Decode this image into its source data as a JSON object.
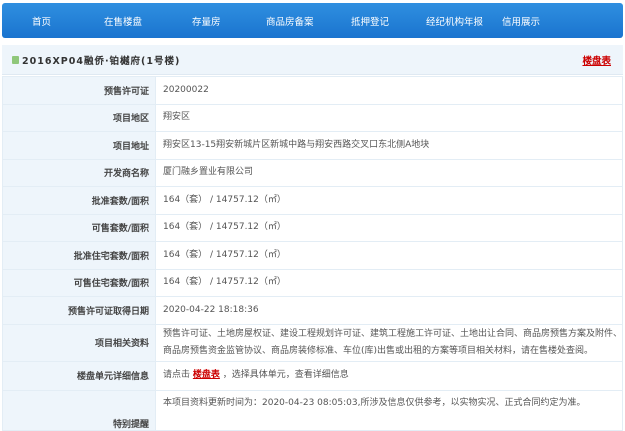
{
  "nav": [
    "首页",
    "在售楼盘",
    "存量房",
    "商品房备案",
    "抵押登记",
    "经纪机构年报",
    "信用展示"
  ],
  "title": "2016XP04融侨·铂樾府(1号楼)",
  "title_link": "楼盘表",
  "rows": [
    {
      "label": "预售许可证",
      "value": "20200022"
    },
    {
      "label": "项目地区",
      "value": "翔安区"
    },
    {
      "label": "项目地址",
      "value": "翔安区13-15翔安新城片区新城中路与翔安西路交叉口东北侧A地块"
    },
    {
      "label": "开发商名称",
      "value": "厦门融乡置业有限公司"
    },
    {
      "label": "批准套数/面积",
      "value": "164（套） / 14757.12（㎡）"
    },
    {
      "label": "可售套数/面积",
      "value": "164（套） / 14757.12（㎡）"
    },
    {
      "label": "批准住宅套数/面积",
      "value": "164（套） / 14757.12（㎡）"
    },
    {
      "label": "可售住宅套数/面积",
      "value": "164（套） / 14757.12（㎡）"
    },
    {
      "label": "预售许可证取得日期",
      "value": "2020-04-22 18:18:36"
    },
    {
      "label": "项目相关资料",
      "value": "预售许可证、土地房屋权证、建设工程规划许可证、建筑工程施工许可证、土地出让合同、商品房预售方案及附件、商品房预售资金监管协议、商品房装修标准、车位(库)出售或出租的方案等项目相关材料，请在售楼处查阅。"
    }
  ],
  "unit_row": {
    "label": "楼盘单元详细信息",
    "pre": "请点击 ",
    "link": "楼盘表",
    "post": " ，选择具体单元，查看详细信息"
  },
  "notice_row": {
    "label": "特别提醒",
    "value": "本项目资料更新时间为：2020-04-23 08:05:03,所涉及信息仅供参考，以实物实况、正式合同约定为准。"
  }
}
